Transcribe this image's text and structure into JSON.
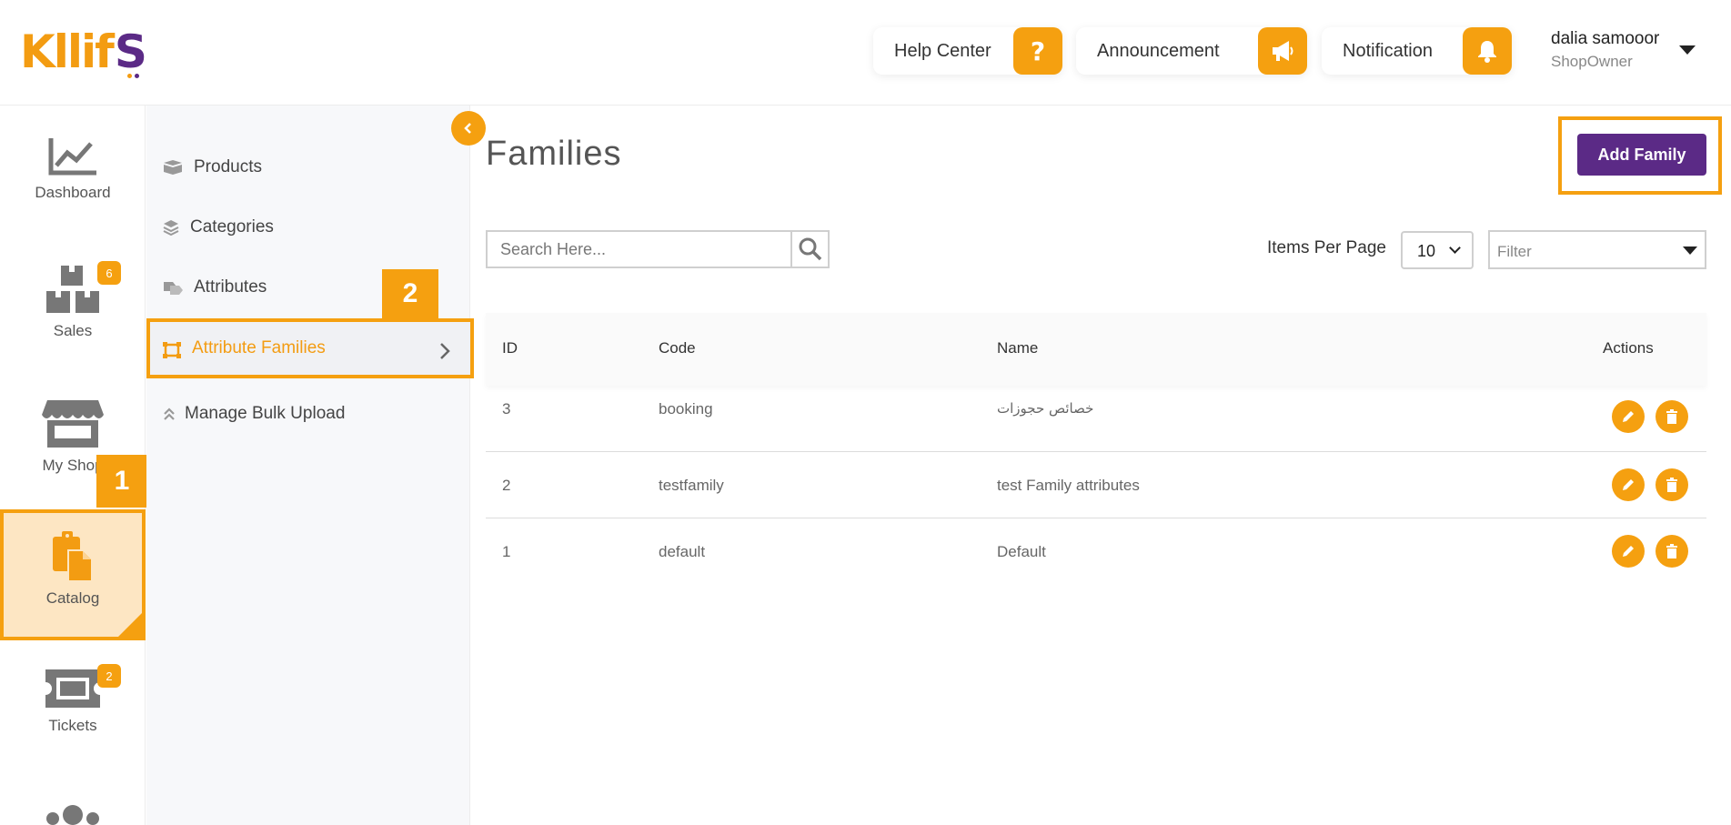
{
  "brand": {
    "logo_main": "Kllif",
    "logo_end": "S"
  },
  "header": {
    "help_label": "Help Center",
    "announcement_label": "Announcement",
    "notification_label": "Notification",
    "user_name": "dalia samooor",
    "user_role": "ShopOwner"
  },
  "iconbar": {
    "items": [
      {
        "label": "Dashboard",
        "icon": "chart-icon"
      },
      {
        "label": "Sales",
        "icon": "boxes-icon",
        "badge": "6"
      },
      {
        "label": "My Shop",
        "icon": "store-icon"
      },
      {
        "label": "Catalog",
        "icon": "clipboard-icon"
      },
      {
        "label": "Tickets",
        "icon": "ticket-icon",
        "badge": "2"
      }
    ]
  },
  "steps": {
    "step1": "1",
    "step2": "2"
  },
  "submenu": {
    "products": "Products",
    "categories": "Categories",
    "attributes": "Attributes",
    "attribute_families": "Attribute Families",
    "bulk_upload": "Manage Bulk Upload"
  },
  "main": {
    "title": "Families",
    "add_button": "Add Family",
    "search_placeholder": "Search Here...",
    "items_per_page_label": "Items Per Page",
    "items_per_page_value": "10",
    "filter_placeholder": "Filter"
  },
  "table": {
    "headers": {
      "id": "ID",
      "code": "Code",
      "name": "Name",
      "actions": "Actions"
    },
    "rows": [
      {
        "id": "3",
        "code": "booking",
        "name": "خصائص حجوزات"
      },
      {
        "id": "2",
        "code": "testfamily",
        "name": "test Family attributes"
      },
      {
        "id": "1",
        "code": "default",
        "name": "Default"
      }
    ]
  },
  "colors": {
    "accent": "#f5a010",
    "brand_purple": "#5b2a86"
  }
}
